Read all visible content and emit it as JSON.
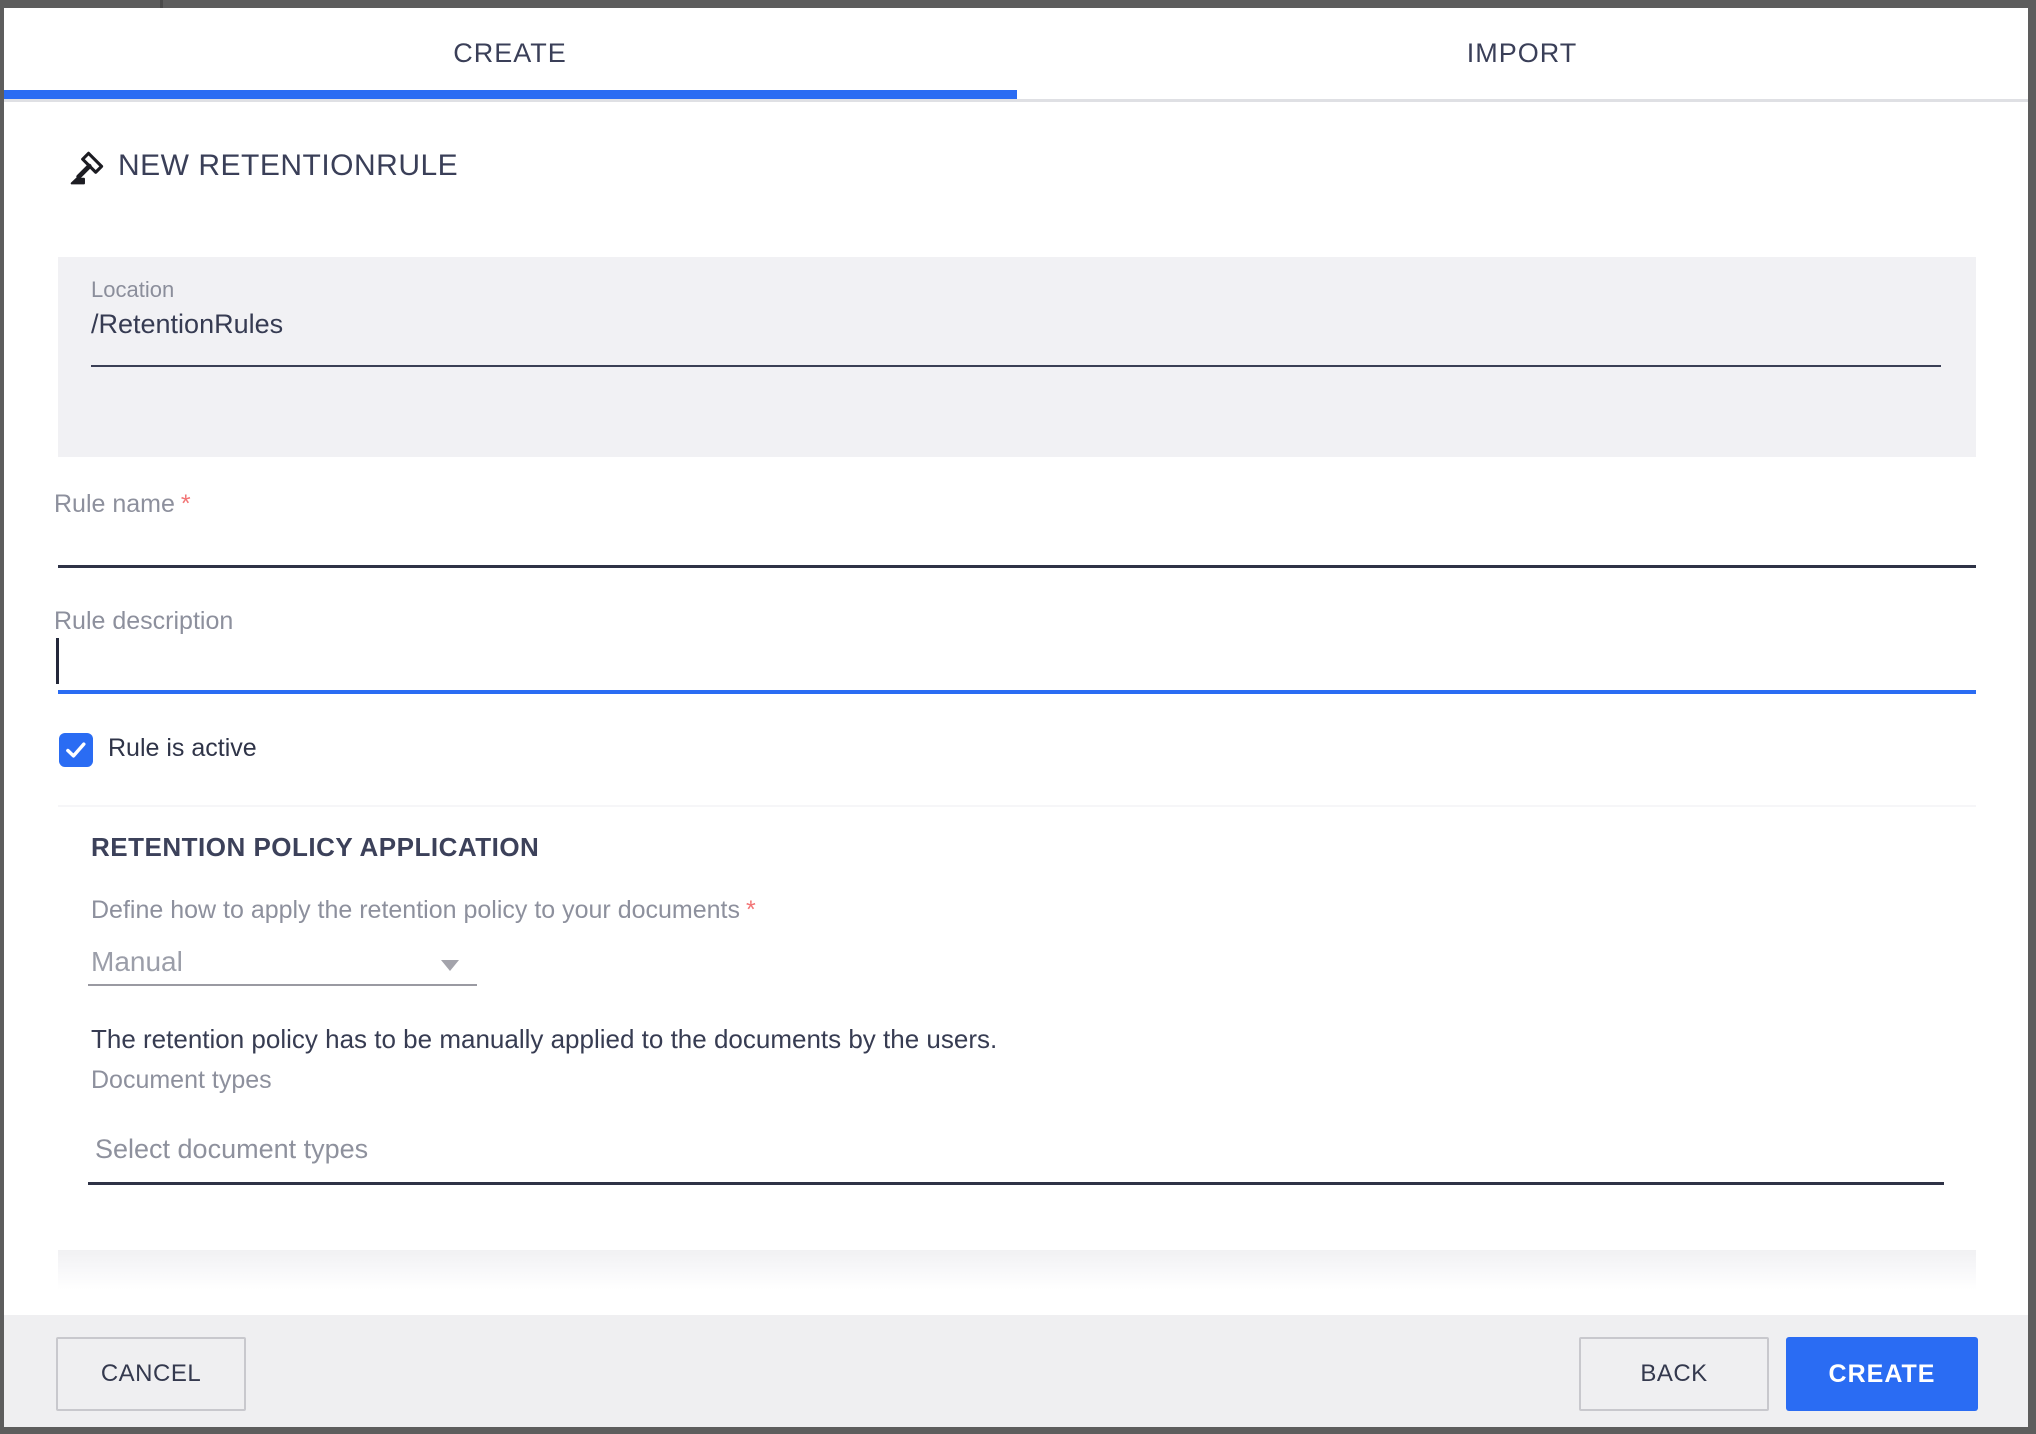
{
  "tabs": {
    "create": "CREATE",
    "import": "IMPORT"
  },
  "header": {
    "icon": "gavel-icon",
    "title": "NEW RETENTIONRULE"
  },
  "form": {
    "location": {
      "label": "Location",
      "value": "/RetentionRules"
    },
    "rule_name": {
      "label": "Rule name",
      "required": "*",
      "value": ""
    },
    "rule_description": {
      "label": "Rule description",
      "value": ""
    },
    "rule_is_active": {
      "label": "Rule is active",
      "checked": true
    },
    "policy": {
      "section_title": "RETENTION POLICY APPLICATION",
      "apply_label": "Define how to apply the retention policy to your documents",
      "apply_required": "*",
      "apply_value": "Manual",
      "apply_helper": "The retention policy has to be manually applied to the documents by the users.",
      "document_types_label": "Document types",
      "document_types_placeholder": "Select document types"
    }
  },
  "footer": {
    "cancel": "CANCEL",
    "back": "BACK",
    "create": "CREATE"
  },
  "colors": {
    "primary_blue": "#2a6cf3",
    "dark_text": "#3a3f58",
    "label_gray": "#8d909d",
    "required_red": "#f27576",
    "footer_bg": "#efeff1",
    "location_card_bg": "#f1f1f4",
    "overlay": "#5d5d5d"
  }
}
